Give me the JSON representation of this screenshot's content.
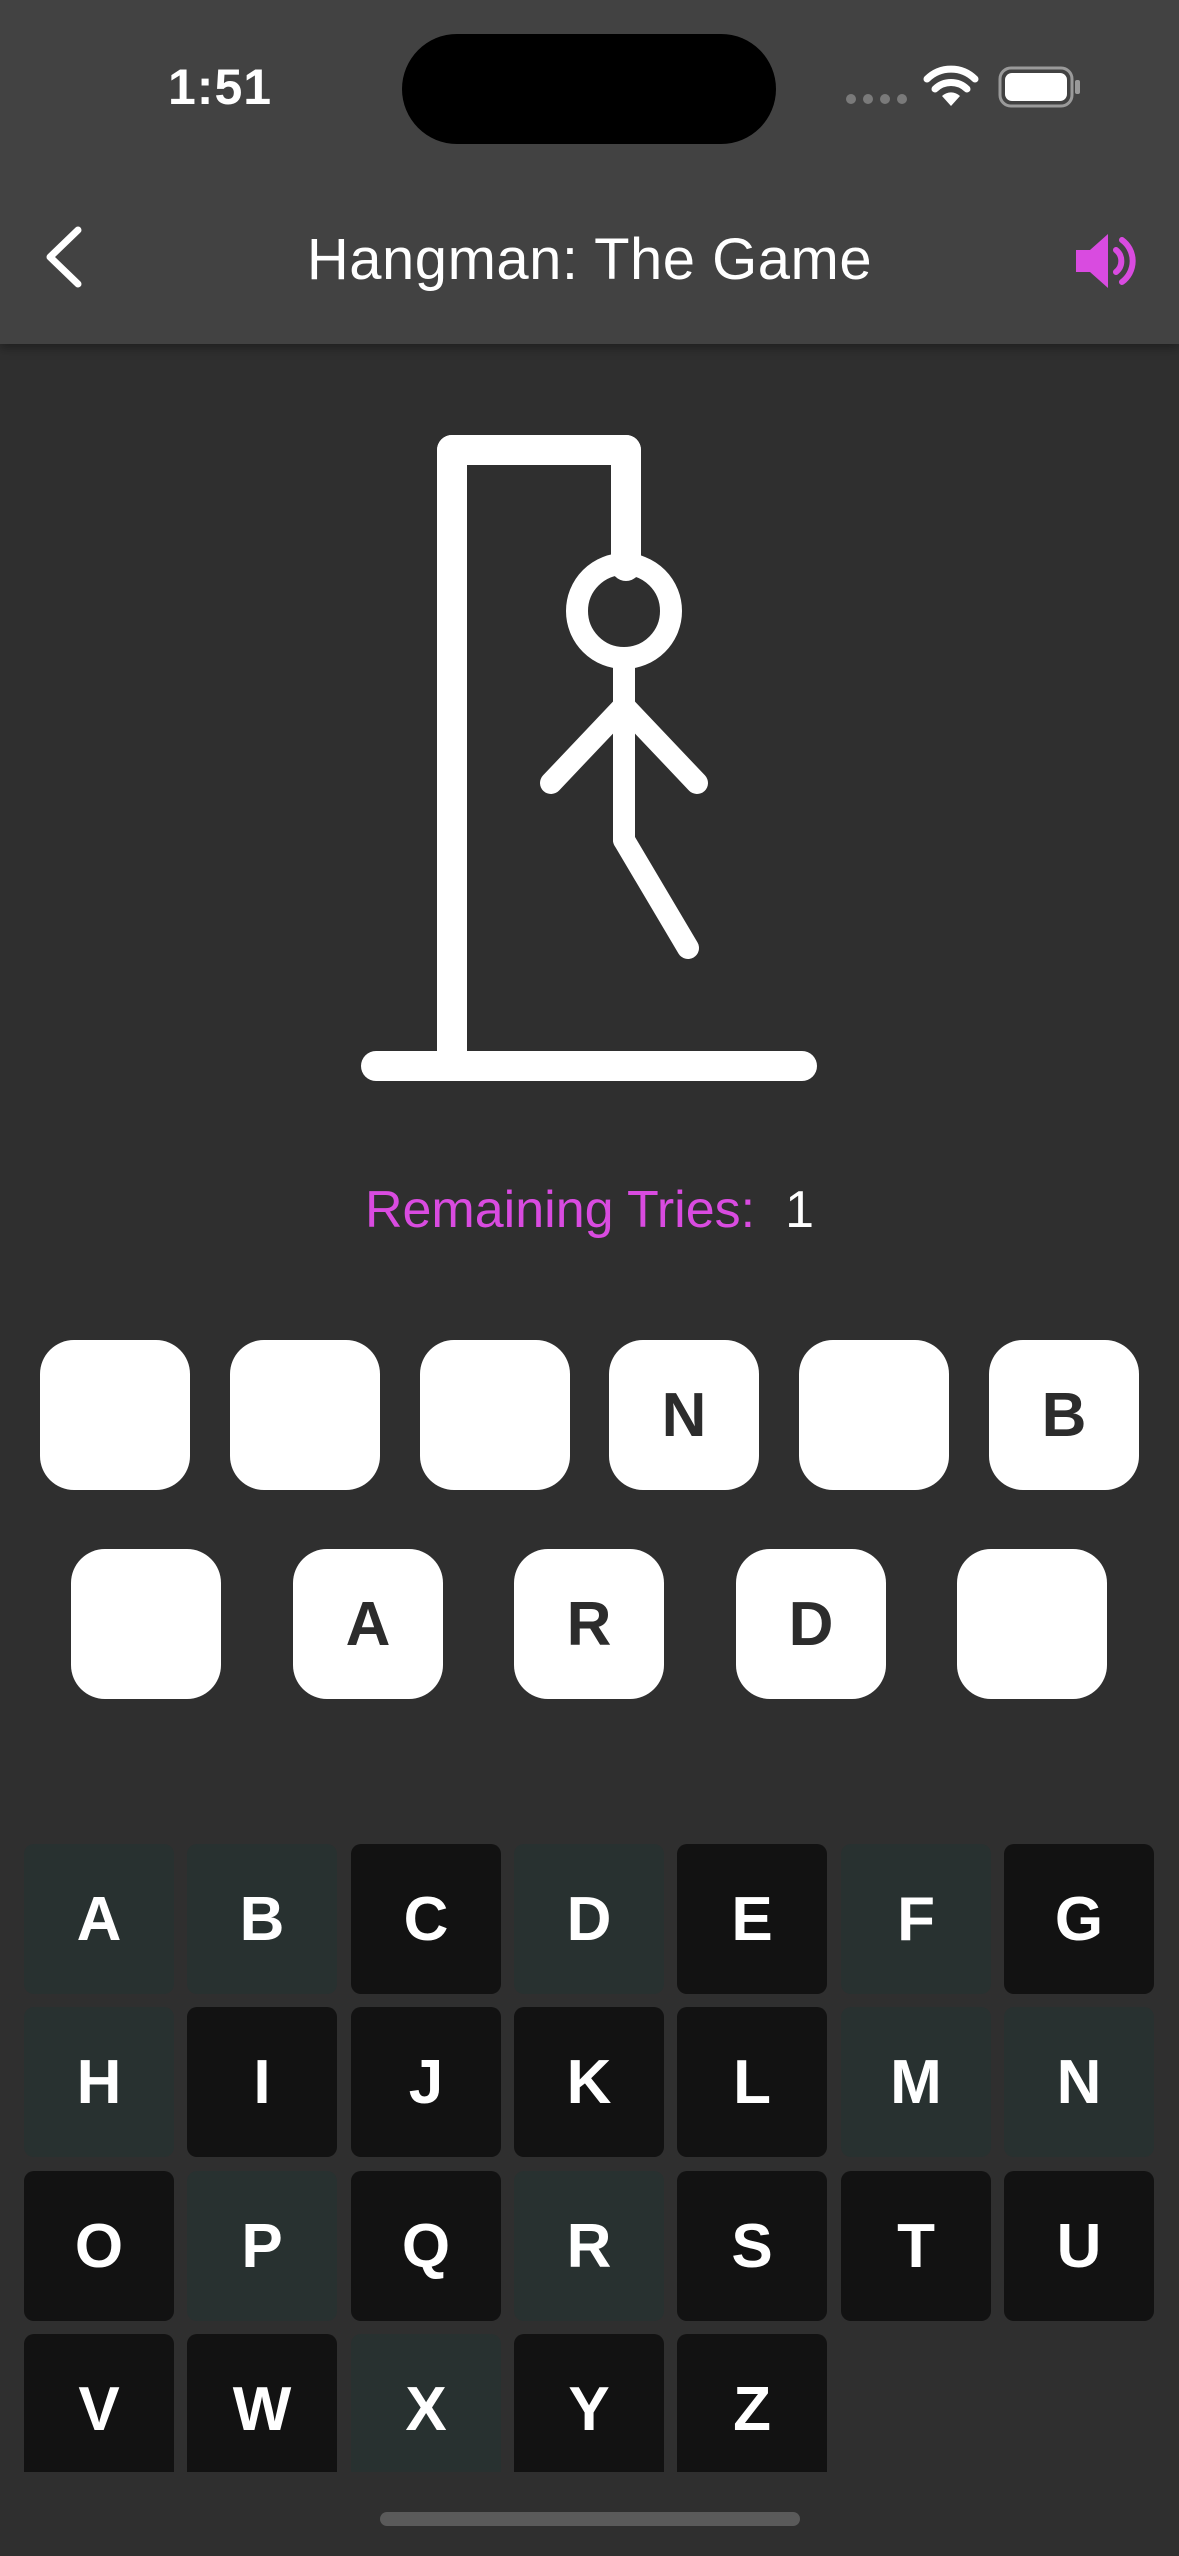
{
  "status": {
    "time": "1:51"
  },
  "nav": {
    "title": "Hangman: The Game",
    "back_icon": "chevron-left-icon",
    "sound_icon": "speaker-icon"
  },
  "colors": {
    "accent": "#d94be0",
    "background": "#2f2f2f",
    "topbar": "#424242",
    "key_used": "#283130",
    "key_available": "#121212"
  },
  "game": {
    "remaining_label": "Remaining Tries:",
    "remaining_value": "1",
    "word_rows": [
      [
        "",
        "",
        "",
        "N",
        "",
        "B"
      ],
      [
        "",
        "A",
        "R",
        "D",
        ""
      ]
    ]
  },
  "keyboard": {
    "keys": [
      {
        "letter": "A",
        "state": "used"
      },
      {
        "letter": "B",
        "state": "used"
      },
      {
        "letter": "C",
        "state": "available"
      },
      {
        "letter": "D",
        "state": "used"
      },
      {
        "letter": "E",
        "state": "available"
      },
      {
        "letter": "F",
        "state": "used"
      },
      {
        "letter": "G",
        "state": "available"
      },
      {
        "letter": "H",
        "state": "used"
      },
      {
        "letter": "I",
        "state": "available"
      },
      {
        "letter": "J",
        "state": "available"
      },
      {
        "letter": "K",
        "state": "available"
      },
      {
        "letter": "L",
        "state": "available"
      },
      {
        "letter": "M",
        "state": "used"
      },
      {
        "letter": "N",
        "state": "used"
      },
      {
        "letter": "O",
        "state": "available"
      },
      {
        "letter": "P",
        "state": "used"
      },
      {
        "letter": "Q",
        "state": "available"
      },
      {
        "letter": "R",
        "state": "used"
      },
      {
        "letter": "S",
        "state": "available"
      },
      {
        "letter": "T",
        "state": "available"
      },
      {
        "letter": "U",
        "state": "available"
      },
      {
        "letter": "V",
        "state": "available"
      },
      {
        "letter": "W",
        "state": "available"
      },
      {
        "letter": "X",
        "state": "used"
      },
      {
        "letter": "Y",
        "state": "available"
      },
      {
        "letter": "Z",
        "state": "available"
      }
    ]
  }
}
